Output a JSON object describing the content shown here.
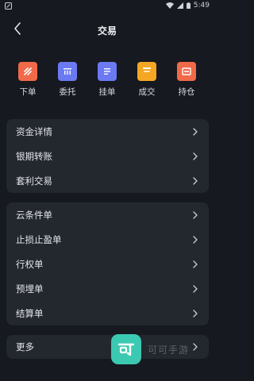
{
  "status_bar": {
    "time": "5:49",
    "icons": [
      "app-notification-icon",
      "wifi-icon",
      "cellular-signal-icon",
      "battery-icon"
    ]
  },
  "header": {
    "title": "交易",
    "back_icon": "chevron-left-icon"
  },
  "quick_actions": [
    {
      "label": "下单",
      "icon": "order-icon",
      "color": "#f06a4a"
    },
    {
      "label": "委托",
      "icon": "entrust-icon",
      "color": "#6b7af2"
    },
    {
      "label": "挂单",
      "icon": "pending-order-icon",
      "color": "#6b7af2"
    },
    {
      "label": "成交",
      "icon": "deal-icon",
      "color": "#f5a623"
    },
    {
      "label": "持仓",
      "icon": "position-icon",
      "color": "#f06a4a"
    }
  ],
  "group1": [
    {
      "label": "资金详情"
    },
    {
      "label": "银期转账"
    },
    {
      "label": "套利交易"
    }
  ],
  "group2": [
    {
      "label": "云条件单"
    },
    {
      "label": "止损止盈单"
    },
    {
      "label": "行权单"
    },
    {
      "label": "预埋单"
    },
    {
      "label": "结算单"
    }
  ],
  "group3": [
    {
      "label": "更多"
    }
  ],
  "watermark": {
    "text": "可可手游",
    "logo_icon": "kk-logo-icon",
    "color": "#3cc9b2"
  }
}
